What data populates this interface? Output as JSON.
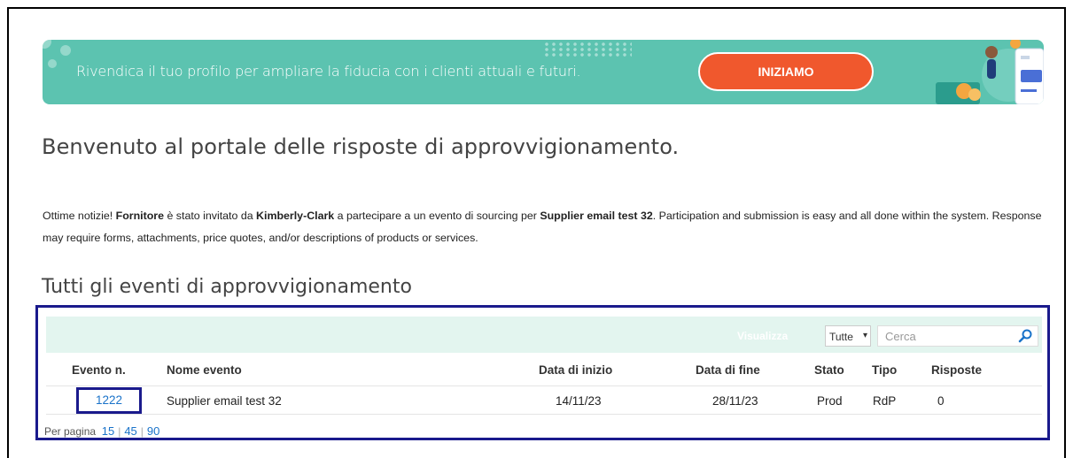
{
  "banner": {
    "message": "Rivendica il tuo profilo per ampliare la fiducia con i clienti attuali e futuri.",
    "cta_label": "INIZIAMO"
  },
  "page_title": "Benvenuto al portale delle risposte di approvvigionamento.",
  "intro": {
    "p1": "Ottime notizie! ",
    "supplier": "Fornitore",
    "p2": " è stato invitato da ",
    "buyer": "Kimberly-Clark",
    "p3": " a partecipare a un evento di sourcing per ",
    "event": "Supplier email test 32",
    "p4": ". Participation and submission is easy and all done within the system. Response may require forms, attachments, price quotes, and/or descriptions of products or services."
  },
  "section_title": "Tutti gli eventi di approvvigionamento",
  "toolbar": {
    "view_label": "Visualizza",
    "filter_value": "Tutte",
    "search_placeholder": "Cerca"
  },
  "table": {
    "headers": [
      "Evento n.",
      "Nome evento",
      "Data di inizio",
      "Data di fine",
      "Stato",
      "Tipo",
      "Risposte"
    ],
    "rows": [
      {
        "id": "1222",
        "name": "Supplier email test 32",
        "start": "14/11/23",
        "end": "28/11/23",
        "status": "Prod",
        "type": "RdP",
        "responses": "0"
      }
    ]
  },
  "pager": {
    "label": "Per pagina",
    "options": [
      "15",
      "45",
      "90"
    ]
  },
  "colors": {
    "banner_bg": "#5cc3b0",
    "cta_bg": "#f0582d",
    "highlight_border": "#1a1a8c",
    "link": "#1a73c9",
    "toolbar_bg": "#e3f5ef"
  }
}
